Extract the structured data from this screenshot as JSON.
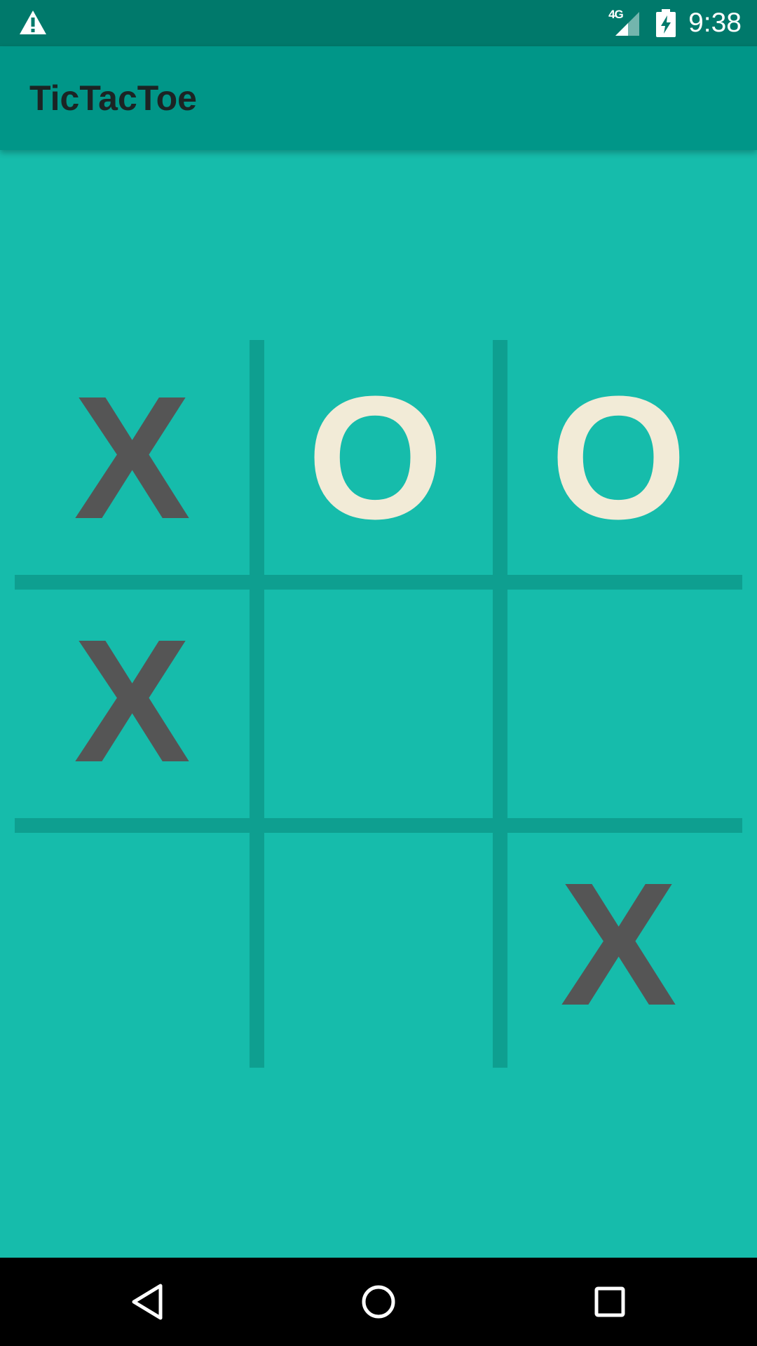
{
  "status_bar": {
    "network_type": "4G",
    "time": "9:38",
    "icons": [
      "warning-icon",
      "signal-icon",
      "battery-charging-icon"
    ]
  },
  "app_bar": {
    "title": "TicTacToe"
  },
  "board": {
    "cells": [
      "X",
      "O",
      "O",
      "X",
      "",
      "",
      "",
      "",
      "X"
    ]
  },
  "nav_bar": {
    "icons": [
      "back-icon",
      "home-icon",
      "recents-icon"
    ]
  },
  "colors": {
    "background": "#16BCAB",
    "app_bar": "#009688",
    "status_bar": "#00796B",
    "grid_line": "#0E9F90",
    "x_mark": "#555555",
    "o_mark": "#F2EBD7"
  }
}
